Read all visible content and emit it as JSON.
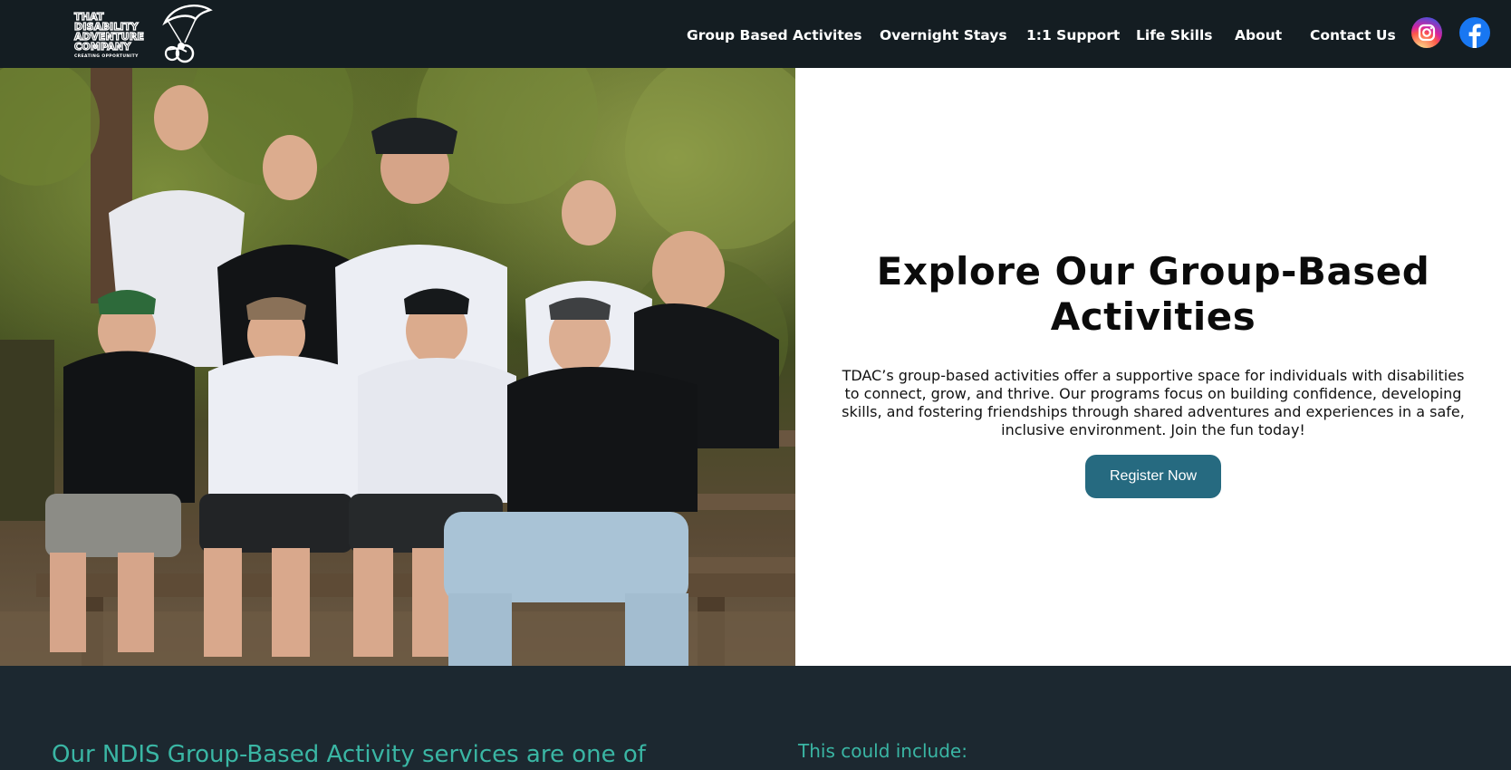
{
  "header": {
    "logo": {
      "lines": [
        "THAT",
        "DISABILITY",
        "ADVENTURE",
        "COMPANY"
      ],
      "tagline": "CREATING OPPORTUNITY"
    },
    "nav": [
      {
        "label": "Group Based Activites"
      },
      {
        "label": "Overnight Stays"
      },
      {
        "label": "1:1 Support"
      },
      {
        "label": "Life Skills"
      },
      {
        "label": "About"
      },
      {
        "label": "Contact Us"
      }
    ],
    "social": [
      {
        "icon": "instagram-icon"
      },
      {
        "icon": "facebook-icon"
      }
    ]
  },
  "hero": {
    "title": "Explore Our Group-Based Activities",
    "description": "TDAC’s group-based activities offer a supportive space for individuals with disabilities to connect, grow, and thrive. Our programs focus on building confidence, developing skills, and fostering friendships through shared adventures and experiences in a safe, inclusive environment. Join the fun today!",
    "button_label": "Register Now"
  },
  "lower": {
    "left_heading": "Our NDIS Group-Based Activity services are one of",
    "right_heading": "This could include:"
  },
  "colors": {
    "header_bg": "#141d22",
    "accent_button": "#266a80",
    "lower_bg": "#1c2830",
    "teal_text": "#3ab6a4"
  }
}
